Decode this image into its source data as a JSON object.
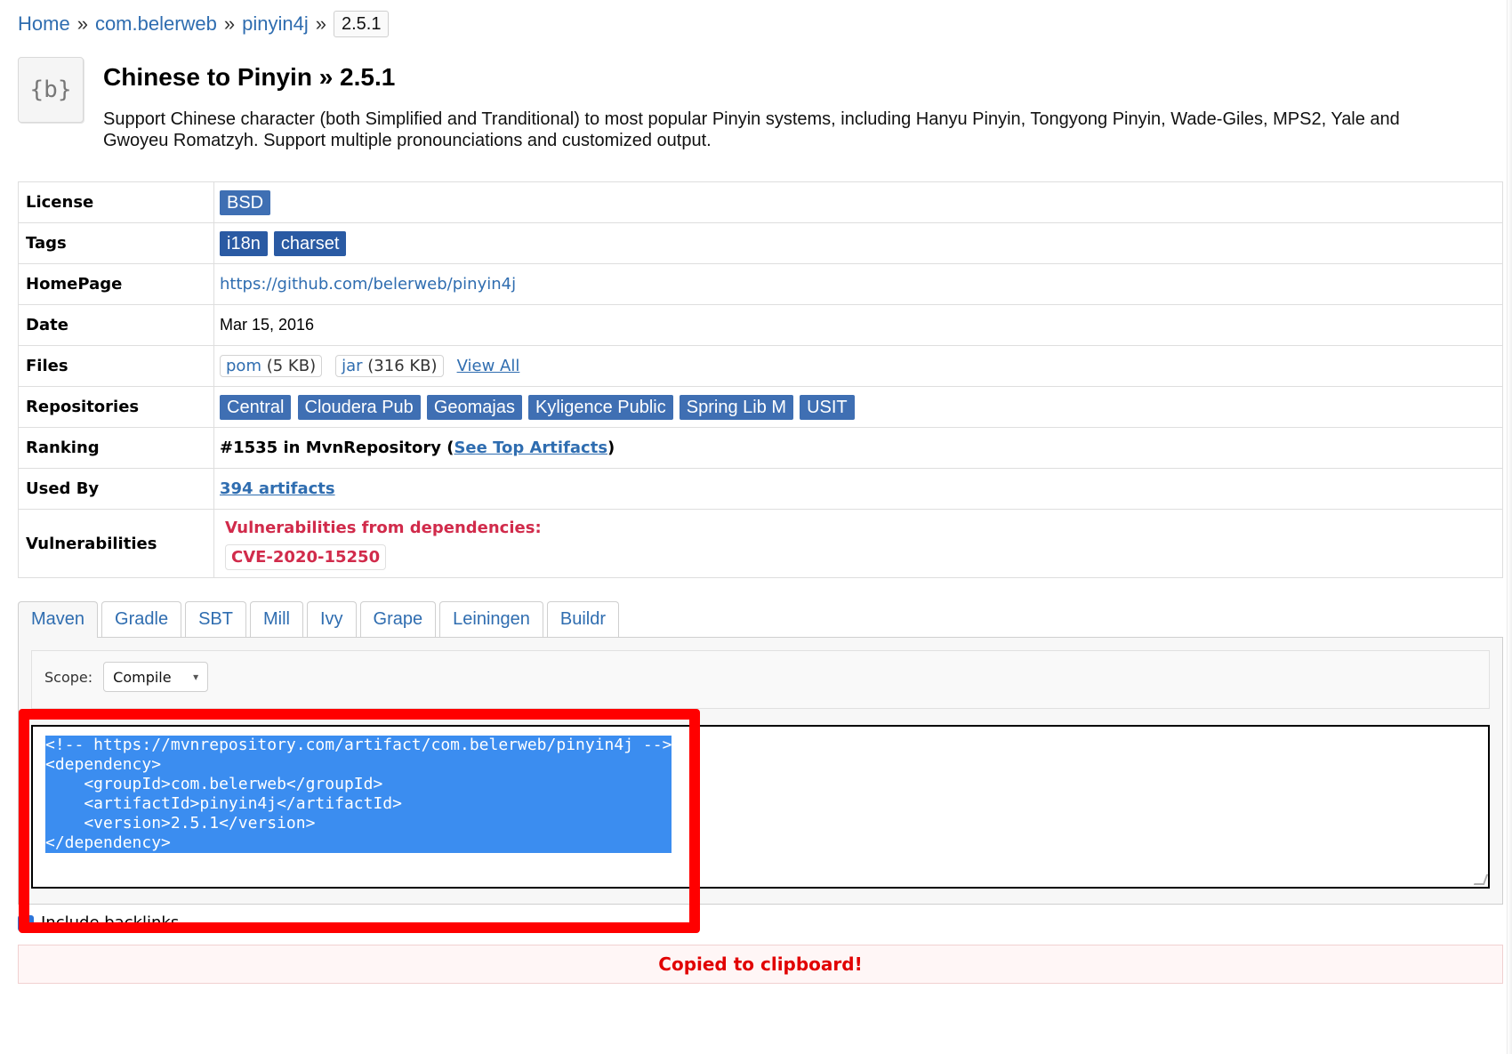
{
  "breadcrumb": {
    "home": "Home",
    "group": "com.belerweb",
    "artifact": "pinyin4j",
    "version": "2.5.1",
    "sep": "»"
  },
  "header": {
    "logo_text": "{b}",
    "title": "Chinese to Pinyin » 2.5.1",
    "description": "Support Chinese character (both Simplified and Tranditional) to most popular Pinyin systems, including Hanyu Pinyin, Tongyong Pinyin, Wade-Giles, MPS2, Yale and Gwoyeu Romatzyh. Support multiple pronounciations and customized output."
  },
  "info": {
    "license_label": "License",
    "license_value": "BSD",
    "tags_label": "Tags",
    "tags": [
      "i18n",
      "charset"
    ],
    "homepage_label": "HomePage",
    "homepage_url": "https://github.com/belerweb/pinyin4j",
    "date_label": "Date",
    "date_value": "Mar 15, 2016",
    "files_label": "Files",
    "files": [
      {
        "name": "pom",
        "size": "(5 KB)"
      },
      {
        "name": "jar",
        "size": "(316 KB)"
      }
    ],
    "files_view_all": "View All",
    "repos_label": "Repositories",
    "repos": [
      "Central",
      "Cloudera Pub",
      "Geomajas",
      "Kyligence Public",
      "Spring Lib M",
      "USIT"
    ],
    "ranking_label": "Ranking",
    "ranking_text": "#1535 in MvnRepository (",
    "ranking_link": "See Top Artifacts",
    "ranking_close": ")",
    "usedby_label": "Used By",
    "usedby_value": "394 artifacts",
    "vulns_label": "Vulnerabilities",
    "vulns_warning": "Vulnerabilities from dependencies:",
    "vulns_cve": "CVE-2020-15250"
  },
  "tabs": [
    "Maven",
    "Gradle",
    "SBT",
    "Mill",
    "Ivy",
    "Grape",
    "Leiningen",
    "Buildr"
  ],
  "active_tab": "Maven",
  "maven": {
    "scope_label": "Scope:",
    "scope_value": "Compile",
    "code": "<!-- https://mvnrepository.com/artifact/com.belerweb/pinyin4j -->\n<dependency>\n    <groupId>com.belerweb</groupId>\n    <artifactId>pinyin4j</artifactId>\n    <version>2.5.1</version>\n</dependency>"
  },
  "backlinks": {
    "label": "Include backlinks",
    "checked": true
  },
  "message": {
    "copied": "Copied to clipboard!"
  },
  "colors": {
    "link": "#2f6db0",
    "badge": "#3f6fb3",
    "warning": "#d12b4b",
    "highlight": "#3b8df0",
    "annotation": "#ff0000"
  }
}
